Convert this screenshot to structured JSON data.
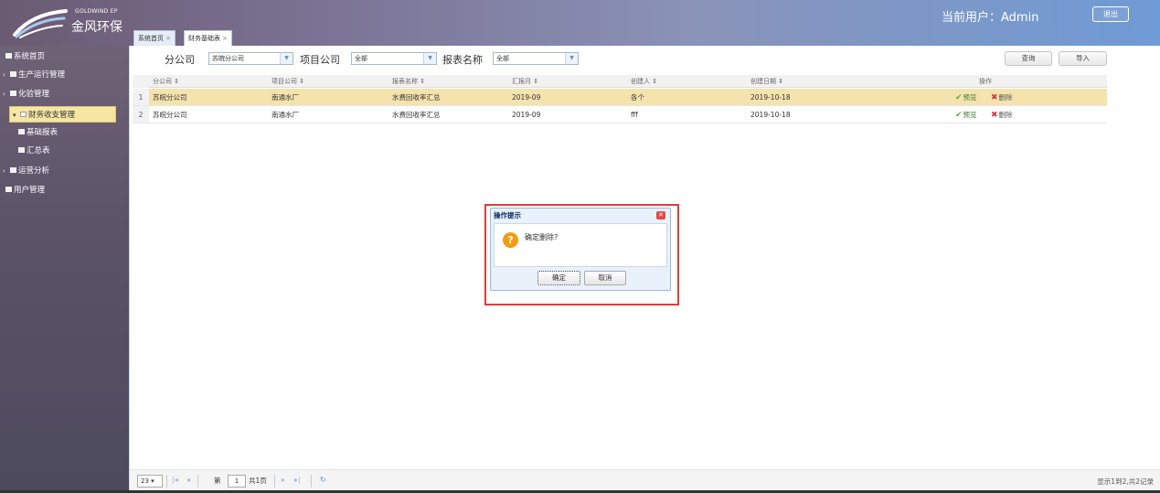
{
  "header": {
    "logo_en": "GOLDWIND EP",
    "logo_cn": "金风环保",
    "current_user_label": "当前用户：",
    "current_user": "Admin",
    "logout_label": "退出"
  },
  "tabs": [
    {
      "label": "系统首页",
      "close": "×"
    },
    {
      "label": "财务基础表",
      "close": "×"
    }
  ],
  "sidebar": {
    "items": [
      {
        "label": "系统首页"
      },
      {
        "label": "生产运行管理"
      },
      {
        "label": "化验管理"
      },
      {
        "label": "财务收支管理"
      },
      {
        "label": "基础报表"
      },
      {
        "label": "汇总表"
      },
      {
        "label": "运营分析"
      },
      {
        "label": "用户管理"
      }
    ]
  },
  "filter": {
    "branch_label": "分公司",
    "branch_value": "苏皖分公司",
    "project_label": "项目公司",
    "project_value": "全部",
    "report_label": "报表名称",
    "report_value": "全部",
    "query_label": "查询",
    "import_label": "导入"
  },
  "grid": {
    "columns": [
      "分公司",
      "项目公司",
      "报表名称",
      "汇报月",
      "创建人",
      "创建日期",
      "操作"
    ],
    "sort_mark": "⇕",
    "rows": [
      {
        "num": "1",
        "branch": "苏皖分公司",
        "project": "南通水厂",
        "report": "水费回收率汇总",
        "month": "2019-09",
        "creator": "各个",
        "date": "2019-10-18",
        "preview": "预览",
        "delete": "删除"
      },
      {
        "num": "2",
        "branch": "苏皖分公司",
        "project": "南通水厂",
        "report": "水费回收率汇总",
        "month": "2019-09",
        "creator": "fff",
        "date": "2019-10-18",
        "preview": "预览",
        "delete": "删除"
      }
    ]
  },
  "pager": {
    "page_size": "23",
    "page_prefix": "第",
    "page_value": "1",
    "page_suffix": "共1页",
    "info": "显示1到2,共2记录"
  },
  "dialog": {
    "title": "操作提示",
    "message": "确定删除?",
    "ok_label": "确定",
    "cancel_label": "取消"
  },
  "colors": {
    "highlight_row": "#f5e3ad",
    "dialog_frame": "#e03c3c",
    "header_end": "#6f9bd6"
  }
}
